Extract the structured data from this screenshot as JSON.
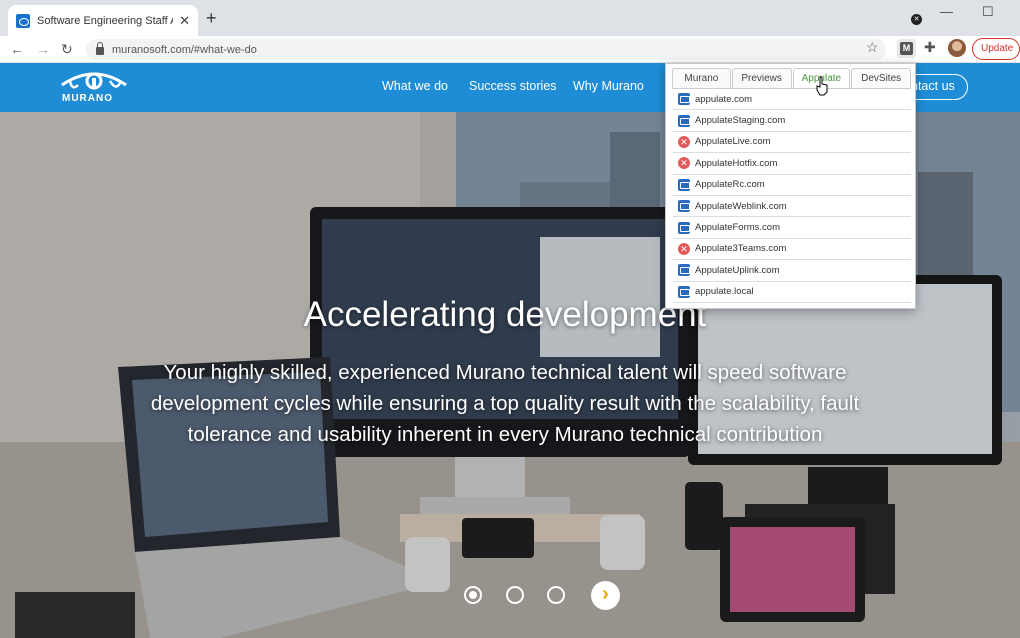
{
  "browser": {
    "tab_title": "Software Engineering Staff Augm",
    "url": "muranosoft.com/#what-we-do",
    "update_label": "Update",
    "extension_label": "M"
  },
  "site": {
    "logo_text": "MURANO",
    "nav": [
      "What we do",
      "Success stories",
      "Why Murano"
    ],
    "contact_label": "ntact us"
  },
  "hero": {
    "title": "Accelerating development",
    "text": "Your highly skilled, experienced Murano technical talent will speed software development cycles while ensuring a top quality result with the scalability, fault tolerance and usability inherent in every Murano technical contribution",
    "slides": 3,
    "active_slide": 1
  },
  "popup": {
    "tabs": [
      "Murano",
      "Previews",
      "Appulate",
      "DevSites"
    ],
    "active_tab": "Appulate",
    "sites": [
      {
        "name": "appulate.com",
        "status": "ok"
      },
      {
        "name": "AppulateStaging.com",
        "status": "ok"
      },
      {
        "name": "AppulateLive.com",
        "status": "error"
      },
      {
        "name": "AppulateHotfix.com",
        "status": "error"
      },
      {
        "name": "AppulateRc.com",
        "status": "ok"
      },
      {
        "name": "AppulateWeblink.com",
        "status": "ok"
      },
      {
        "name": "AppulateForms.com",
        "status": "ok"
      },
      {
        "name": "Appulate3Teams.com",
        "status": "error"
      },
      {
        "name": "AppulateUplink.com",
        "status": "ok"
      },
      {
        "name": "appulate.local",
        "status": "ok"
      }
    ]
  },
  "colors": {
    "brand_blue": "#1f8dd6",
    "active_tab_green": "#4a9a3a",
    "error_red": "#e25b5b",
    "ok_blue": "#2a6bbf"
  }
}
